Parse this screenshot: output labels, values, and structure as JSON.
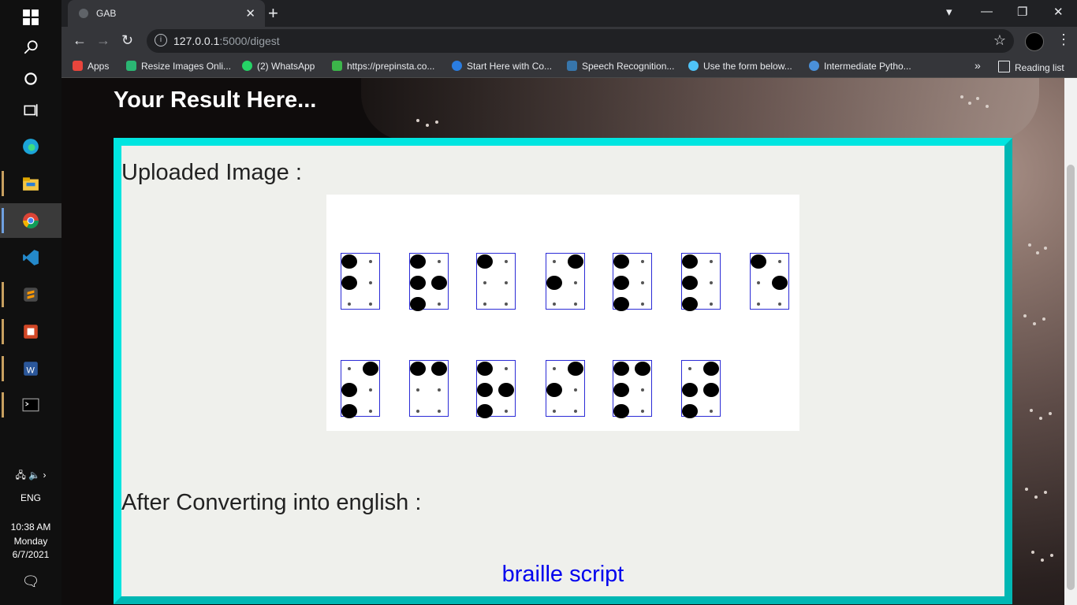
{
  "taskbar": {
    "time": "10:38 AM",
    "day": "Monday",
    "date": "6/7/2021",
    "lang": "ENG"
  },
  "browser": {
    "tab_title": "GAB",
    "url_host": "127.0.0.1",
    "url_path": ":5000/digest",
    "bookmarks": [
      {
        "label": "Apps",
        "color": "#e8453c"
      },
      {
        "label": "Resize Images Onli...",
        "color": "#2bb673"
      },
      {
        "label": "(2) WhatsApp",
        "color": "#25d366"
      },
      {
        "label": "https://prepinsta.co...",
        "color": "#3cb54a"
      },
      {
        "label": "Start Here with Co...",
        "color": "#2a7de1"
      },
      {
        "label": "Speech Recognition...",
        "color": "#3776ab"
      },
      {
        "label": "Use the form below...",
        "color": "#4fc3f7"
      },
      {
        "label": "Intermediate Pytho...",
        "color": "#4a90d9"
      }
    ],
    "more_bookmarks": "»",
    "reading_list": "Reading list"
  },
  "page": {
    "heading": "Your Result Here...",
    "uploaded_label": "Uploaded Image :",
    "converted_label": "After Converting into english :",
    "result_text": "braille script"
  },
  "braille_cells": [
    {
      "row": 0,
      "col": 0,
      "dots": [
        1,
        0,
        1,
        0,
        0,
        0
      ]
    },
    {
      "row": 0,
      "col": 1,
      "dots": [
        1,
        0,
        1,
        1,
        1,
        0
      ]
    },
    {
      "row": 0,
      "col": 2,
      "dots": [
        1,
        0,
        0,
        0,
        0,
        0
      ]
    },
    {
      "row": 0,
      "col": 3,
      "dots": [
        0,
        1,
        1,
        0,
        0,
        0
      ]
    },
    {
      "row": 0,
      "col": 4,
      "dots": [
        1,
        0,
        1,
        0,
        1,
        0
      ]
    },
    {
      "row": 0,
      "col": 5,
      "dots": [
        1,
        0,
        1,
        0,
        1,
        0
      ]
    },
    {
      "row": 0,
      "col": 6,
      "dots": [
        1,
        0,
        0,
        1,
        0,
        0
      ]
    },
    {
      "row": 1,
      "col": 0,
      "dots": [
        0,
        1,
        1,
        0,
        1,
        0
      ]
    },
    {
      "row": 1,
      "col": 1,
      "dots": [
        1,
        1,
        0,
        0,
        0,
        0
      ]
    },
    {
      "row": 1,
      "col": 2,
      "dots": [
        1,
        0,
        1,
        1,
        1,
        0
      ]
    },
    {
      "row": 1,
      "col": 3,
      "dots": [
        0,
        1,
        1,
        0,
        0,
        0
      ]
    },
    {
      "row": 1,
      "col": 4,
      "dots": [
        1,
        1,
        1,
        0,
        1,
        0
      ]
    },
    {
      "row": 1,
      "col": 5,
      "dots": [
        0,
        1,
        1,
        1,
        1,
        0
      ]
    }
  ]
}
